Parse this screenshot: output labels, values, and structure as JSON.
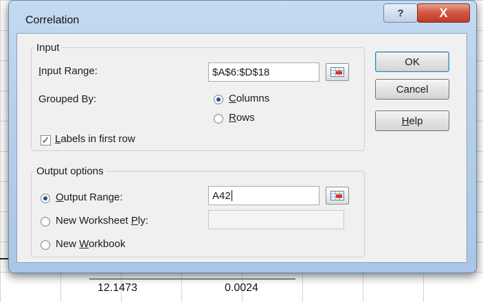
{
  "dialog": {
    "title": "Correlation",
    "help_glyph": "?",
    "close_glyph": "X",
    "input_group": {
      "legend": "Input",
      "input_range_label": "Input Range:",
      "input_range_value": "$A$6:$D$18",
      "grouped_by_label": "Grouped By:",
      "columns_label": "Columns",
      "rows_label": "Rows",
      "grouped_by_selected": "Columns",
      "labels_checkbox_label": "Labels in first row",
      "labels_checked": true
    },
    "output_group": {
      "legend": "Output options",
      "output_range_label": "Output Range:",
      "output_range_value": "A42",
      "new_worksheet_label": "New Worksheet Ply:",
      "new_worksheet_value": "",
      "new_workbook_label": "New Workbook",
      "selected": "Output Range"
    },
    "buttons": {
      "ok": "OK",
      "cancel": "Cancel",
      "help": "Help"
    }
  },
  "sheet": {
    "visible_values": [
      "12.1473",
      "0.0024"
    ]
  },
  "colors": {
    "window_frame": "#b6d0ea",
    "close_button": "#c0392b",
    "client_area": "#f0f0f0",
    "default_button_border": "#3c7fb1"
  },
  "icons": [
    "help-icon",
    "close-icon",
    "range-selector-icon"
  ]
}
